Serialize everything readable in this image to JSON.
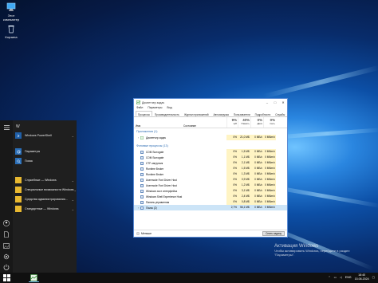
{
  "desktop": {
    "icons": [
      {
        "label": "Этот\nкомпьютер",
        "icon": "computer-icon"
      },
      {
        "label": "Корзина",
        "icon": "recycle-bin-icon"
      }
    ]
  },
  "start_menu": {
    "letter_w": "W",
    "apps": [
      {
        "label": "Windows PowerShell",
        "chevron": "⌄"
      },
      {
        "label": "Параметры",
        "chevron": ""
      },
      {
        "label": "Поиск",
        "chevron": ""
      },
      {
        "label": "Служебные — Windows",
        "chevron": "⌄"
      },
      {
        "label": "Специальные возможности Windows",
        "chevron": "⌄"
      },
      {
        "label": "Средства администрирования...",
        "chevron": "⌄"
      },
      {
        "label": "Стандартные — Windows",
        "chevron": "⌄"
      }
    ]
  },
  "task_manager": {
    "title": "Диспетчер задач",
    "menu": [
      "Файл",
      "Параметры",
      "Вид"
    ],
    "tabs": [
      "Процессы",
      "Производительность",
      "Журнал приложений",
      "Автозагрузка",
      "Пользователи",
      "Подробности",
      "Службы"
    ],
    "columns": {
      "name": "Имя",
      "status": "Состояние",
      "cpu": {
        "pct": "9%",
        "caption": "ЦП"
      },
      "mem": {
        "pct": "40%",
        "caption": "Память"
      },
      "disk": {
        "pct": "0%",
        "caption": "Диск"
      },
      "net": {
        "pct": "0%",
        "caption": "Сеть"
      }
    },
    "group_apps": "Приложения (1)",
    "apps_rows": [
      {
        "name": "Диспетчер задач",
        "cpu": "0%",
        "mem": "21,0 МБ",
        "disk": "0 МБ/с",
        "net": "0 Мбит/с"
      }
    ],
    "group_bg": "Фоновые процессы (13)",
    "bg_rows": [
      {
        "name": "COM Surrogate",
        "cpu": "0%",
        "mem": "1,5 МБ",
        "disk": "0 МБ/с",
        "net": "0 Мбит/с"
      },
      {
        "name": "COM Surrogate",
        "cpu": "0%",
        "mem": "1,1 МБ",
        "disk": "0 МБ/с",
        "net": "0 Мбит/с"
      },
      {
        "name": "CTF-загрузчик",
        "cpu": "0%",
        "mem": "2,1 МБ",
        "disk": "0 МБ/с",
        "net": "0 Мбит/с"
      },
      {
        "name": "Runtime Broker",
        "cpu": "0%",
        "mem": "1,5 МБ",
        "disk": "0 МБ/с",
        "net": "0 Мбит/с"
      },
      {
        "name": "Runtime Broker",
        "cpu": "0%",
        "mem": "1,3 МБ",
        "disk": "0 МБ/с",
        "net": "0 Мбит/с"
      },
      {
        "name": "Usermode Font Driver Host",
        "cpu": "0%",
        "mem": "0,9 МБ",
        "disk": "0 МБ/с",
        "net": "0 Мбит/с"
      },
      {
        "name": "Usermode Font Driver Host",
        "cpu": "0%",
        "mem": "1,2 МБ",
        "disk": "0 МБ/с",
        "net": "0 Мбит/с"
      },
      {
        "name": "Windows хост интерфейса",
        "cpu": "0%",
        "mem": "3,1 МБ",
        "disk": "0 МБ/с",
        "net": "0 Мбит/с"
      },
      {
        "name": "Windows Shell Experience Host",
        "cpu": "0%",
        "mem": "2,4 МБ",
        "disk": "0 МБ/с",
        "net": "0 Мбит/с"
      },
      {
        "name": "Панель управления",
        "cpu": "0%",
        "mem": "0,8 МБ",
        "disk": "0 МБ/с",
        "net": "0 Мбит/с"
      },
      {
        "name": "Поиск (2)",
        "cpu": "2,7%",
        "mem": "56,1 МБ",
        "disk": "0 МБ/с",
        "net": "0 Мбит/с"
      }
    ],
    "footer_less": "Меньше",
    "footer_end_task": "Снять задачу"
  },
  "activation": {
    "line1": "Активация Windows",
    "line2": "Чтобы активировать Windows, перейдите в раздел",
    "line3": "\"Параметры\"."
  },
  "taskbar": {
    "lang": "ENG",
    "time": "18:40",
    "date": "15.06.2024"
  }
}
